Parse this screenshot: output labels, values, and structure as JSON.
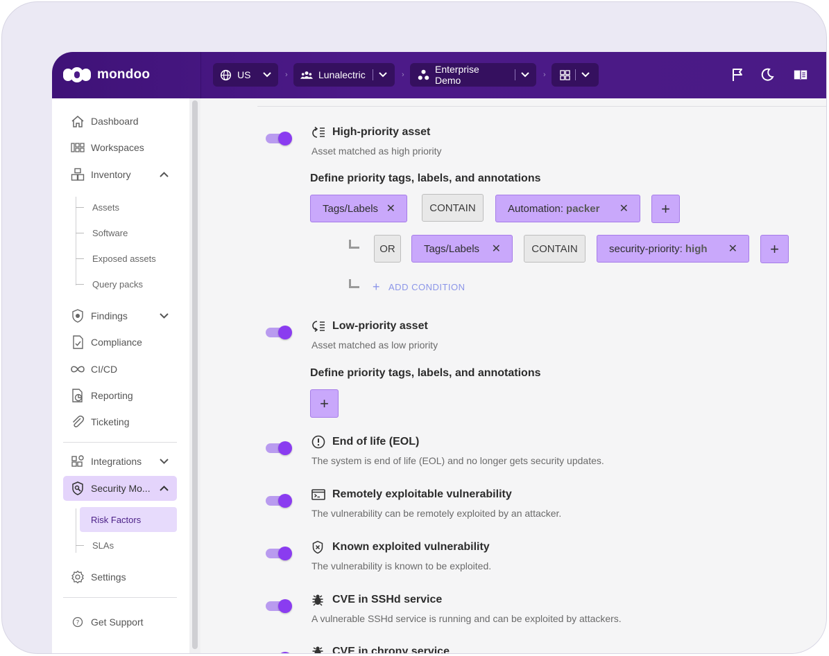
{
  "brand": {
    "name": "mondoo"
  },
  "topbar": {
    "region": "US",
    "organization": "Lunalectric",
    "space": "Enterprise Demo"
  },
  "sidebar": {
    "items": [
      {
        "label": "Dashboard"
      },
      {
        "label": "Workspaces"
      },
      {
        "label": "Inventory"
      },
      {
        "label": "Findings"
      },
      {
        "label": "Compliance"
      },
      {
        "label": "CI/CD"
      },
      {
        "label": "Reporting"
      },
      {
        "label": "Ticketing"
      },
      {
        "label": "Integrations"
      },
      {
        "label": "Security Mo..."
      },
      {
        "label": "Settings"
      },
      {
        "label": "Get Support"
      }
    ],
    "inventory_sub": [
      "Assets",
      "Software",
      "Exposed assets",
      "Query packs"
    ],
    "security_sub": [
      "Risk Factors",
      "SLAs"
    ]
  },
  "risk_factors": [
    {
      "title": "High-priority asset",
      "description": "Asset matched as high priority",
      "enabled": true
    },
    {
      "title": "Low-priority asset",
      "description": "Asset matched as low priority",
      "enabled": true
    },
    {
      "title": "End of life (EOL)",
      "description": "The system is end of life (EOL) and no longer gets security updates.",
      "enabled": true
    },
    {
      "title": "Remotely exploitable vulnerability",
      "description": "The vulnerability can be remotely exploited by an attacker.",
      "enabled": true
    },
    {
      "title": "Known exploited vulnerability",
      "description": "The vulnerability is known to be exploited.",
      "enabled": true
    },
    {
      "title": "CVE in SSHd service",
      "description": "A vulnerable SSHd service is running and can be exploited by attackers.",
      "enabled": true
    },
    {
      "title": "CVE in chrony service",
      "description": "",
      "enabled": true
    }
  ],
  "define_heading": "Define priority tags, labels, and annotations",
  "conditions": {
    "row1": {
      "field": "Tags/Labels",
      "operator": "CONTAIN",
      "key": "Automation:",
      "value": "packer"
    },
    "row2": {
      "logic": "OR",
      "field": "Tags/Labels",
      "operator": "CONTAIN",
      "key": "security-priority:",
      "value": "high"
    },
    "add_condition": "ADD CONDITION",
    "remove_symbol": "✕",
    "add_symbol": "+"
  },
  "colors": {
    "topbar": "#4c1a88",
    "accent": "#8a3cf0",
    "chip": "#c9a8fb",
    "link": "#8b95e8"
  }
}
